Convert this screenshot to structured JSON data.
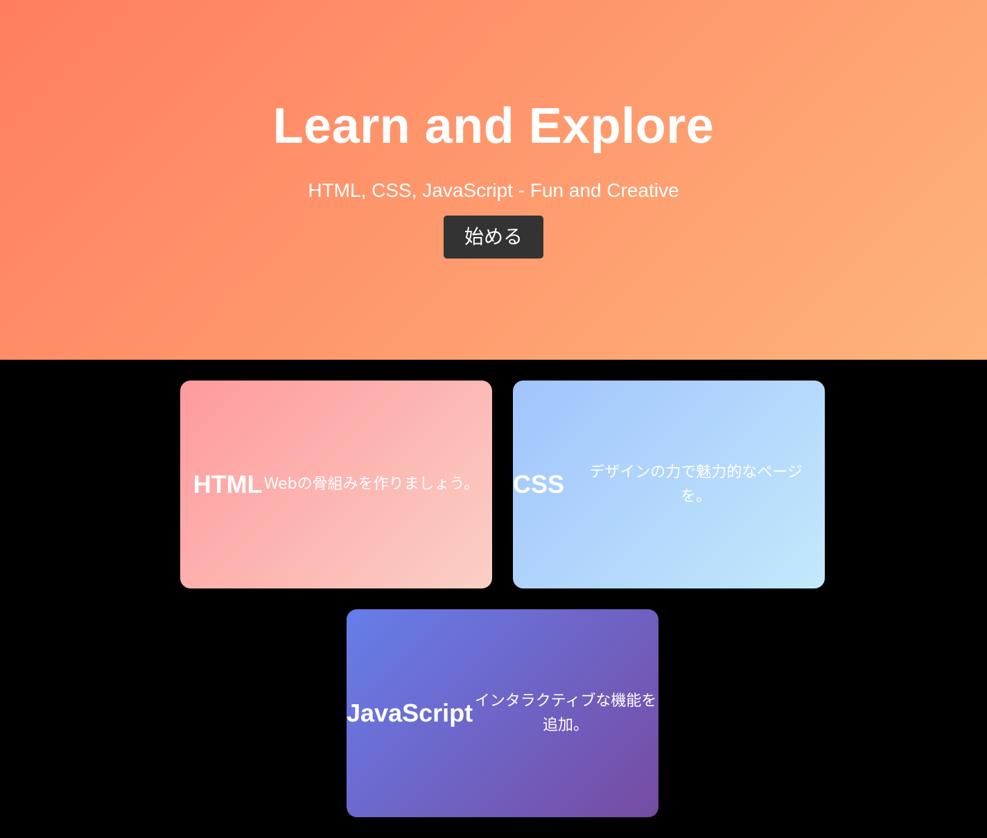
{
  "hero": {
    "title": "Learn and Explore",
    "subtitle": "HTML, CSS, JavaScript - Fun and Creative",
    "button_label": "始める"
  },
  "cards": [
    {
      "title": "HTML",
      "description": "Webの骨組みを作りましょう。",
      "gradient": [
        "#ff9a9e",
        "#fad0c4"
      ]
    },
    {
      "title": "CSS",
      "description": "デザインの力で魅力的なページを。",
      "gradient": [
        "#a1c4fd",
        "#c2e9fb"
      ]
    },
    {
      "title": "JavaScript",
      "description": "インタラクティブな機能を追加。",
      "gradient": [
        "#667eea",
        "#764ba2"
      ]
    }
  ],
  "colors": {
    "hero_gradient": [
      "#ff7e5f",
      "#feb47b"
    ],
    "button_bg": "#333333",
    "page_bg": "#000000"
  }
}
